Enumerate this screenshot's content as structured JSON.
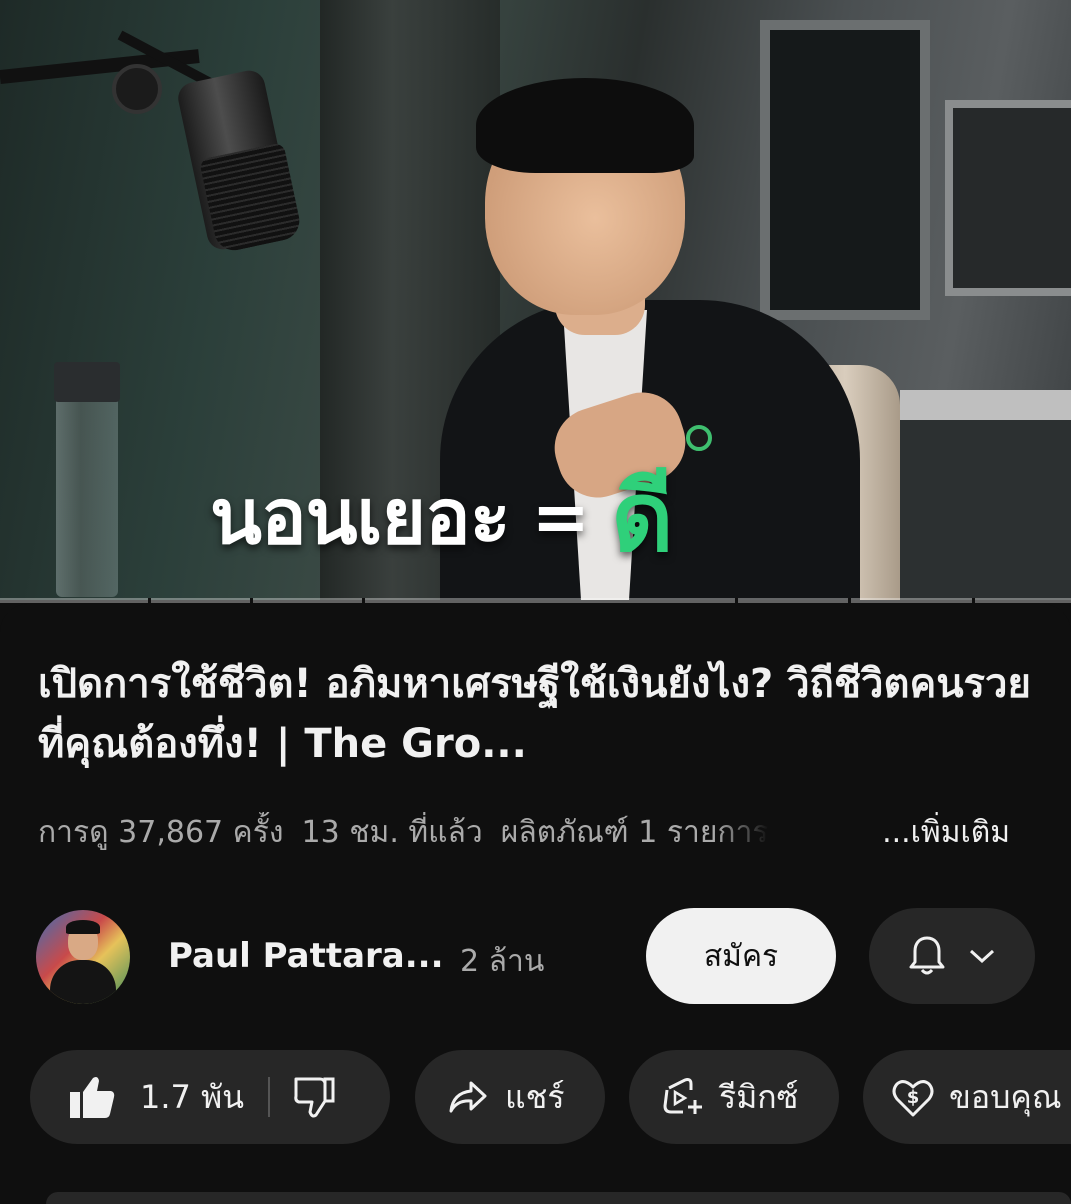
{
  "video": {
    "caption_left": "นอนเยอะ",
    "caption_equals": "=",
    "caption_right": "ดี",
    "progress_fraction": 0.0
  },
  "details": {
    "title": "เปิดการใช้ชีวิต! อภิมหาเศรษฐีใช้เงินยังไง? วิถีชีวิตคนรวยที่คุณต้องทึ่ง! | The Gro...",
    "views": "การดู 37,867 ครั้ง",
    "age": "13 ชม. ที่แล้ว",
    "products": "ผลิตภัณฑ์ 1 รายการ",
    "more": "...เพิ่มเติม"
  },
  "channel": {
    "name": "Paul Pattara...",
    "subscribers": "2 ล้าน",
    "subscribe_label": "สมัคร",
    "bell_icon": "bell-icon",
    "chevron_icon": "chevron-down-icon"
  },
  "actions": {
    "like_count": "1.7 พัน",
    "share_label": "แชร์",
    "remix_label": "รีมิกซ์",
    "thanks_label": "ขอบคุณ"
  },
  "colors": {
    "background": "#0f0f0f",
    "pill": "#272727",
    "caption_accent": "#2fd07a",
    "subscribe_bg": "#f1f1f1",
    "progress": "#ff0033"
  }
}
